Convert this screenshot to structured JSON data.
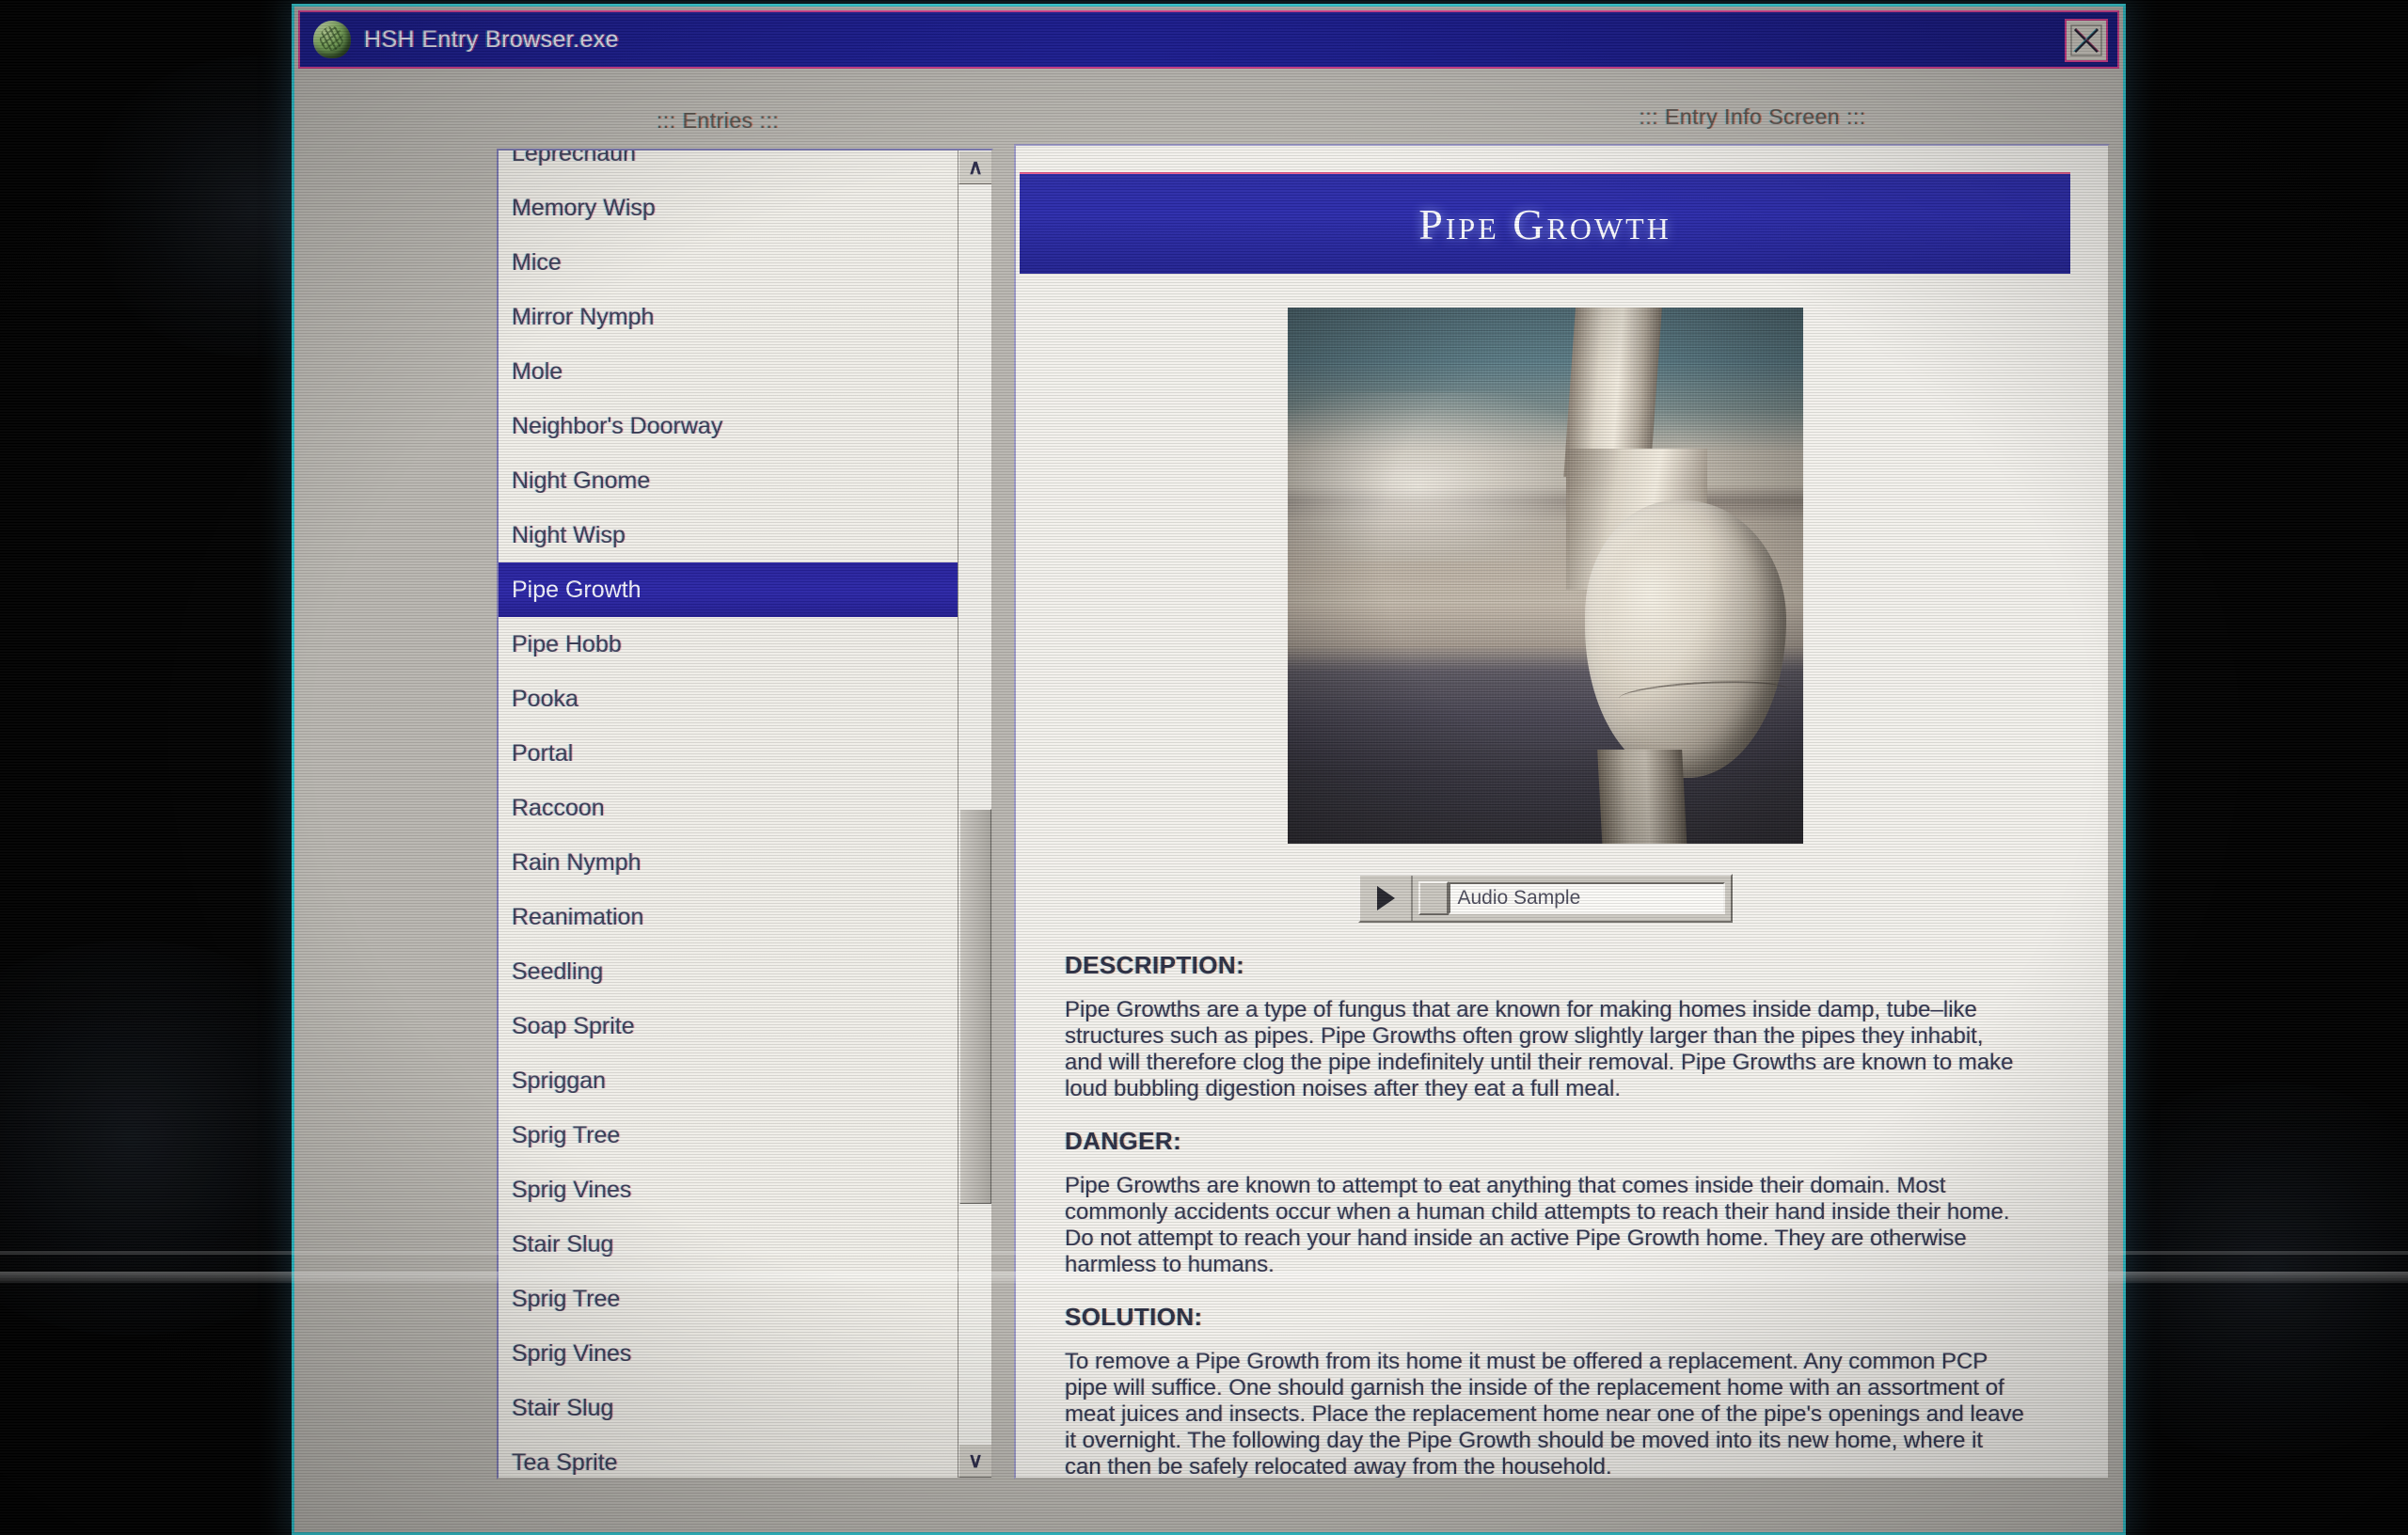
{
  "window": {
    "title": "HSH Entry Browser.exe",
    "icon": "brain-icon",
    "close_label": "close-icon"
  },
  "panels": {
    "entries_heading": "::: Entries :::",
    "info_heading": "::: Entry Info Screen :::"
  },
  "entries": {
    "items": [
      {
        "label": "Leprechaun",
        "selected": false
      },
      {
        "label": "Memory Wisp",
        "selected": false
      },
      {
        "label": "Mice",
        "selected": false
      },
      {
        "label": "Mirror Nymph",
        "selected": false
      },
      {
        "label": "Mole",
        "selected": false
      },
      {
        "label": "Neighbor's Doorway",
        "selected": false
      },
      {
        "label": "Night Gnome",
        "selected": false
      },
      {
        "label": "Night Wisp",
        "selected": false
      },
      {
        "label": "Pipe Growth",
        "selected": true
      },
      {
        "label": "Pipe Hobb",
        "selected": false
      },
      {
        "label": "Pooka",
        "selected": false
      },
      {
        "label": "Portal",
        "selected": false
      },
      {
        "label": "Raccoon",
        "selected": false
      },
      {
        "label": "Rain Nymph",
        "selected": false
      },
      {
        "label": "Reanimation",
        "selected": false
      },
      {
        "label": "Seedling",
        "selected": false
      },
      {
        "label": "Soap Sprite",
        "selected": false
      },
      {
        "label": "Spriggan",
        "selected": false
      },
      {
        "label": "Sprig Tree",
        "selected": false
      },
      {
        "label": "Sprig Vines",
        "selected": false
      },
      {
        "label": "Stair Slug",
        "selected": false
      },
      {
        "label": "Sprig Tree",
        "selected": false
      },
      {
        "label": "Sprig Vines",
        "selected": false
      },
      {
        "label": "Stair Slug",
        "selected": false
      },
      {
        "label": "Tea Sprite",
        "selected": false
      }
    ],
    "scroll_up": "∧",
    "scroll_down": "∨"
  },
  "entry": {
    "title": "Pipe Growth",
    "image_alt": "photograph of a household pipe with a large bulbous growth",
    "audio": {
      "play_label": "play-icon",
      "track_label": "Audio Sample"
    },
    "sections": [
      {
        "heading": "DESCRIPTION:",
        "body": "Pipe Growths are a type of fungus that are known for making homes inside damp, tube–like structures such as pipes. Pipe Growths often grow slightly larger than the pipes they inhabit, and will therefore clog the pipe indefinitely until their removal. Pipe Growths are known to make loud bubbling digestion noises after they eat a full meal."
      },
      {
        "heading": "DANGER:",
        "body": "Pipe Growths are known to attempt to eat anything that comes inside their domain. Most commonly accidents occur when a human child attempts to reach their hand inside their home. Do not attempt to reach your hand inside an active Pipe Growth home. They are otherwise harmless to humans."
      },
      {
        "heading": "SOLUTION:",
        "body": "To remove a Pipe Growth from its home it must be offered a replacement. Any common PCP pipe will suffice. One should garnish the inside of the replacement home with an assortment of meat juices and insects. Place the replacement home near one of the pipe's openings and leave it overnight. The following day the Pipe Growth should be moved into its new home, where it can then be safely relocated away from the household."
      }
    ]
  },
  "colors": {
    "titlebar_blue": "#1c1d96",
    "title_border_pink": "#d33b8c",
    "window_border_cyan": "#2ec4cf",
    "selection_blue": "#2a25a6",
    "entry_banner_blue": "#2b2bab",
    "window_face": "#b9b6b0",
    "list_face": "#f0eee8"
  }
}
